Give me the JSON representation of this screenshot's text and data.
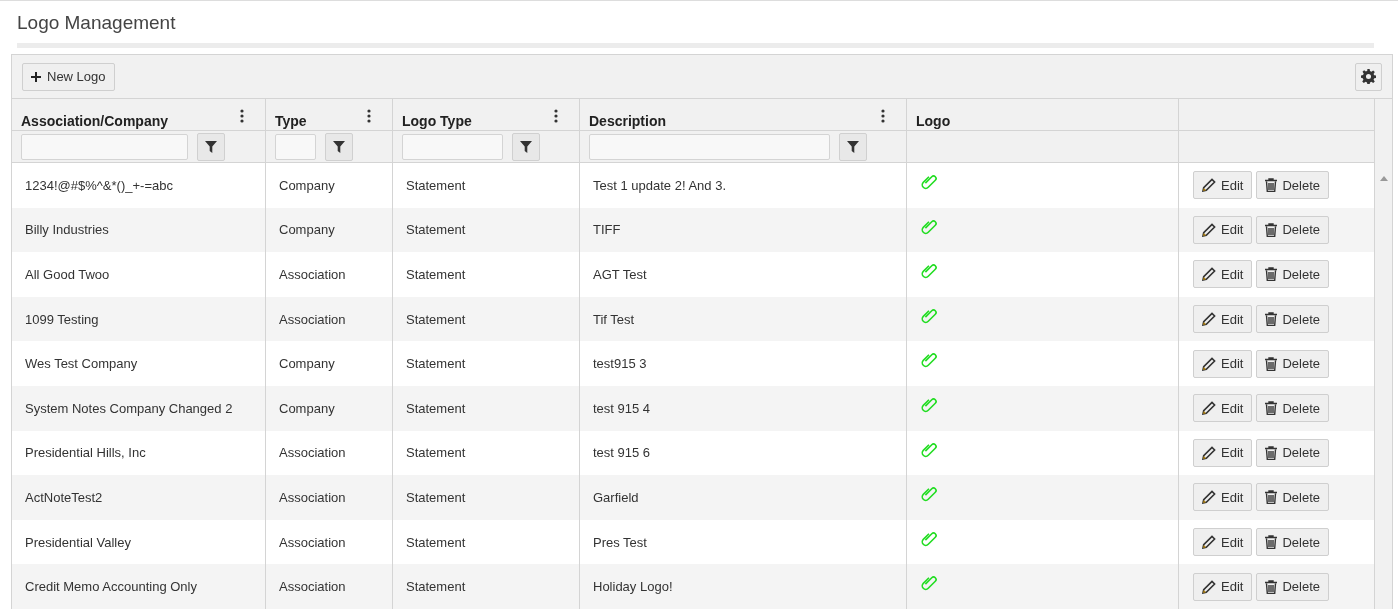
{
  "page": {
    "title": "Logo Management"
  },
  "toolbar": {
    "new_button": "New Logo"
  },
  "table": {
    "columns": [
      {
        "label": "Association/Company",
        "menu": true,
        "filter": true
      },
      {
        "label": "Type",
        "menu": true,
        "filter": true
      },
      {
        "label": "Logo Type",
        "menu": true,
        "filter": true
      },
      {
        "label": "Description",
        "menu": true,
        "filter": true
      },
      {
        "label": "Logo",
        "menu": false,
        "filter": false
      }
    ],
    "rows": [
      {
        "company": "1234!@#$%^&*()_+-=abc",
        "type": "Company",
        "logo_type": "Statement",
        "description": "Test 1 update 2! And 3.",
        "edit": "Edit",
        "delete": "Delete"
      },
      {
        "company": "Billy Industries",
        "type": "Company",
        "logo_type": "Statement",
        "description": "TIFF",
        "edit": "Edit",
        "delete": "Delete"
      },
      {
        "company": "All Good Twoo",
        "type": "Association",
        "logo_type": "Statement",
        "description": "AGT Test",
        "edit": "Edit",
        "delete": "Delete"
      },
      {
        "company": "1099 Testing",
        "type": "Association",
        "logo_type": "Statement",
        "description": "Tif Test",
        "edit": "Edit",
        "delete": "Delete"
      },
      {
        "company": "Wes Test Company",
        "type": "Company",
        "logo_type": "Statement",
        "description": "test915 3",
        "edit": "Edit",
        "delete": "Delete"
      },
      {
        "company": "System Notes Company Changed 2",
        "type": "Company",
        "logo_type": "Statement",
        "description": "test 915 4",
        "edit": "Edit",
        "delete": "Delete"
      },
      {
        "company": "Presidential Hills, Inc",
        "type": "Association",
        "logo_type": "Statement",
        "description": "test 915 6",
        "edit": "Edit",
        "delete": "Delete"
      },
      {
        "company": "ActNoteTest2",
        "type": "Association",
        "logo_type": "Statement",
        "description": "Garfield",
        "edit": "Edit",
        "delete": "Delete"
      },
      {
        "company": "Presidential Valley",
        "type": "Association",
        "logo_type": "Statement",
        "description": "Pres Test",
        "edit": "Edit",
        "delete": "Delete"
      },
      {
        "company": "Credit Memo Accounting Only",
        "type": "Association",
        "logo_type": "Statement",
        "description": "Holiday Logo!",
        "edit": "Edit",
        "delete": "Delete"
      }
    ]
  }
}
